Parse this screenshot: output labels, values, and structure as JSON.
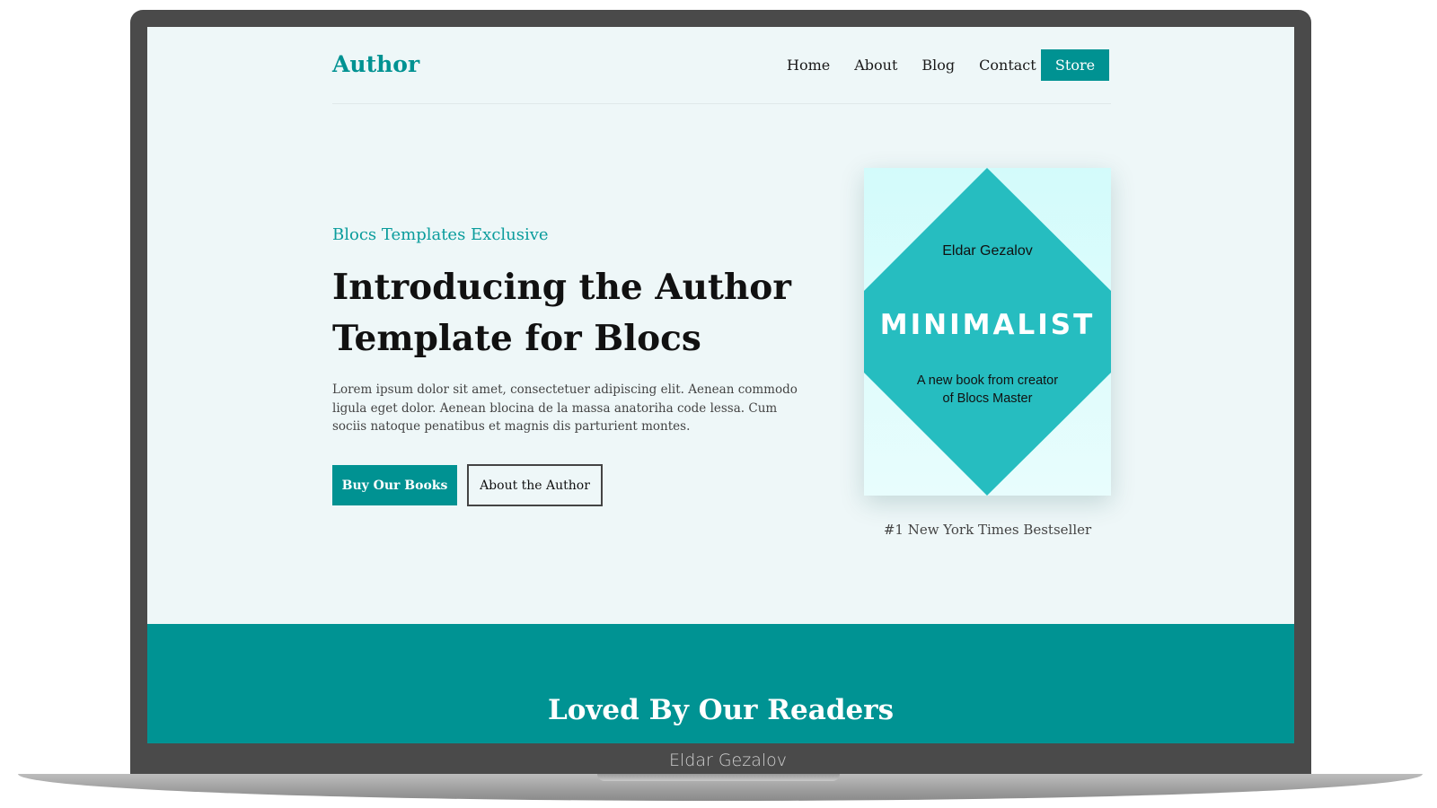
{
  "device": {
    "bezel_label": "Eldar Gezalov"
  },
  "nav": {
    "brand": "Author",
    "links": [
      "Home",
      "About",
      "Blog",
      "Contact"
    ],
    "store_label": "Store"
  },
  "hero": {
    "eyebrow": "Blocs Templates Exclusive",
    "title": "Introducing the Author Template for Blocs",
    "body": "Lorem ipsum dolor sit amet, consectetuer adipiscing elit. Aenean commodo ligula eget dolor. Aenean blocina de la massa anatoriha code lessa. Cum sociis natoque penatibus et magnis dis parturient montes.",
    "primary_button": "Buy Our Books",
    "secondary_button": "About the Author"
  },
  "book": {
    "author": "Eldar Gezalov",
    "title": "MINIMALIST",
    "subtitle": "A new book from creator of Blocs Master",
    "caption": "#1 New York Times Bestseller"
  },
  "readers": {
    "title": "Loved By Our Readers"
  },
  "colors": {
    "accent": "#009292",
    "book_diamond": "#26bdc0",
    "page_bg": "#eef7f8",
    "bezel": "#4a4a4a"
  }
}
